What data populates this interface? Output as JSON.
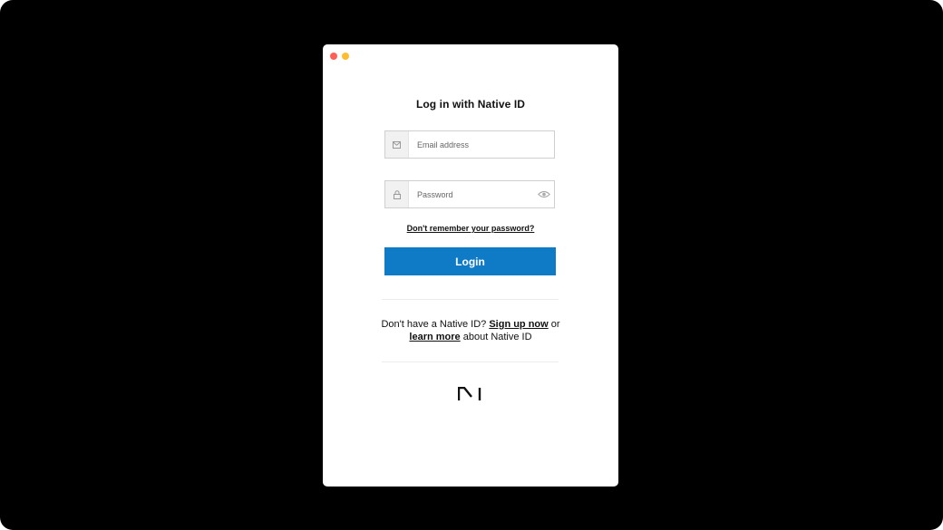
{
  "window": {
    "controls": [
      {
        "name": "close",
        "color": "#ff5f57"
      },
      {
        "name": "minimize",
        "color": "#febc2e"
      }
    ]
  },
  "login": {
    "title": "Log in with Native ID",
    "email": {
      "placeholder": "Email address",
      "value": "",
      "icon": "email-icon"
    },
    "password": {
      "placeholder": "Password",
      "value": "",
      "icon": "lock-icon",
      "toggle_icon": "eye-icon"
    },
    "forgot_label": "Don't remember your password?",
    "login_label": "Login",
    "accent_color": "#0f7bc6"
  },
  "signup": {
    "prefix": "Don't have a Native ID?",
    "signup_link": "Sign up now",
    "middle": "or",
    "learn_link": "learn more",
    "suffix": "about Native ID"
  },
  "branding": {
    "logo": "native-logo"
  }
}
